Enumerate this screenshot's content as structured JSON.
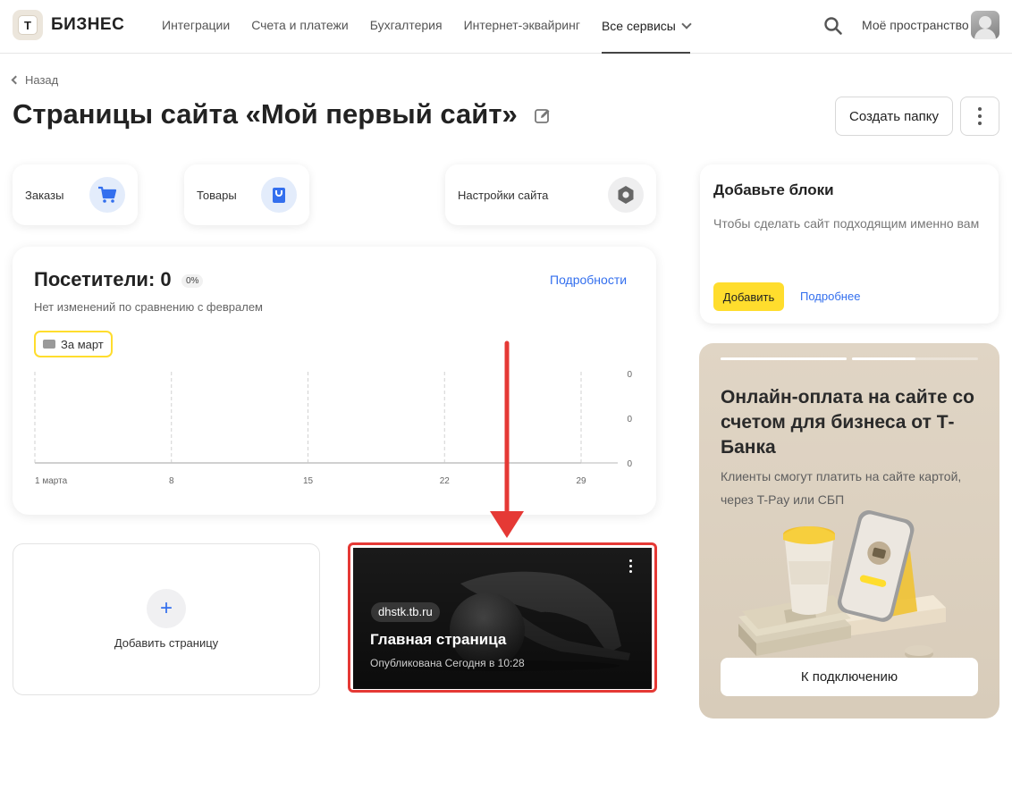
{
  "header": {
    "logo_badge": "T",
    "logo_text": "БИЗНЕС",
    "nav": [
      {
        "label": "Интеграции"
      },
      {
        "label": "Счета и платежи"
      },
      {
        "label": "Бухгалтерия"
      },
      {
        "label": "Интернет-эквайринг"
      },
      {
        "label": "Все сервисы"
      }
    ],
    "space_label": "Моё пространство"
  },
  "page": {
    "back_label": "Назад",
    "title": "Страницы сайта «Мой первый сайт»",
    "create_folder_label": "Создать папку"
  },
  "quick_links": {
    "orders": "Заказы",
    "products": "Товары",
    "settings": "Настройки сайта"
  },
  "visitors": {
    "title": "Посетители: 0",
    "badge": "0%",
    "details_link": "Подробности",
    "subtitle": "Нет изменений по сравнению с февралем",
    "period": "За март"
  },
  "chart_data": {
    "type": "line",
    "x": [
      "1 марта",
      "8",
      "15",
      "22",
      "29"
    ],
    "series": [
      {
        "values": [
          0,
          0,
          0,
          0,
          0
        ]
      }
    ],
    "y_ticks": [
      "0",
      "0",
      "0"
    ],
    "grid": true
  },
  "pages": {
    "add_label": "Добавить страницу",
    "add_symbol": "+",
    "main": {
      "domain": "dhstk.tb.ru",
      "title": "Главная страница",
      "status": "Опубликована Сегодня в 10:28"
    }
  },
  "blocks": {
    "title": "Добавьте блоки",
    "text": "Чтобы сделать сайт подходящим именно вам",
    "add_label": "Добавить",
    "more_label": "Подробнее"
  },
  "promo": {
    "title": "Онлайн-оплата на сайте со счетом для бизнеса от Т-Банка",
    "text": "Клиенты смогут платить на сайте картой, через T-Pay или СБП",
    "button_label": "К подключению",
    "slides_total": 2,
    "slide_progress": [
      1.0,
      0.5
    ]
  },
  "colors": {
    "accent_yellow": "#ffdd2d",
    "link_blue": "#336fee",
    "highlight_red": "#e53935"
  }
}
